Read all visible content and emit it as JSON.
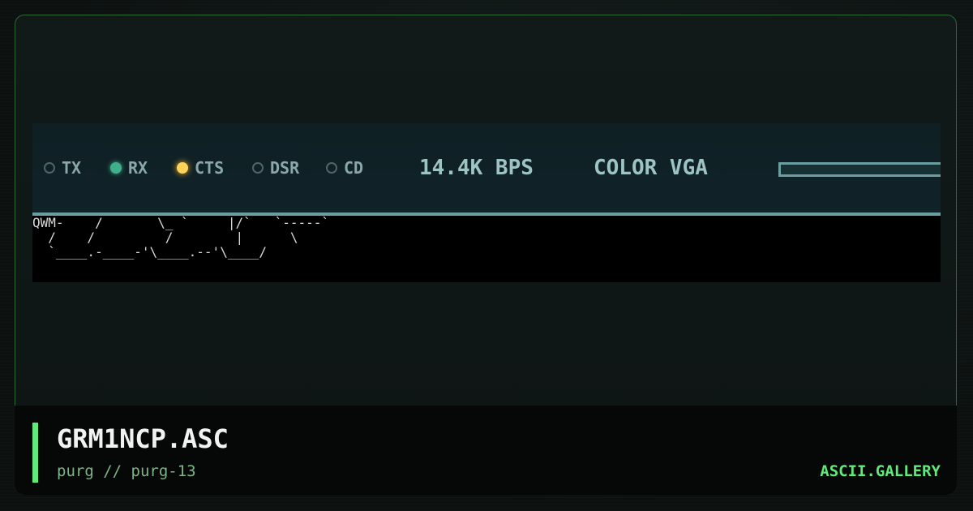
{
  "artwork": {
    "status_bar": {
      "indicators": [
        {
          "label": "TX",
          "state": "off",
          "color": "#4f6567"
        },
        {
          "label": "RX",
          "state": "on",
          "color": "#3fb08a"
        },
        {
          "label": "CTS",
          "state": "on",
          "color": "#ffd35a"
        },
        {
          "label": "DSR",
          "state": "off",
          "color": "#4f6567"
        },
        {
          "label": "CD",
          "state": "off",
          "color": "#4f6567"
        }
      ],
      "speed": "14.4K BPS",
      "display_mode": "COLOR VGA"
    },
    "ascii_text": "QWM-    /       \\_ `     |/`   `-----`\n  /    /         /        |      \\\n  `____.-____-'\\____.--'\\____/"
  },
  "caption": {
    "title": "GRM1NCP.ASC",
    "subtitle": "purg // purg-13",
    "brand": "ASCII.GALLERY"
  },
  "colors": {
    "accent": "#5fea7a",
    "frame_border": "#2b6a34",
    "status_text": "#9ec3c3"
  }
}
